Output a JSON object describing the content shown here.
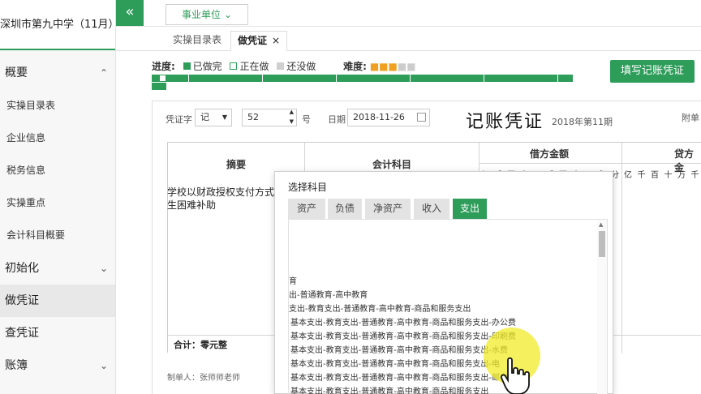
{
  "sidebar": {
    "school": "深圳市第九中学（11月）",
    "sections": [
      {
        "label": "概要",
        "chevron": "up"
      },
      {
        "label": "初始化",
        "chevron": "down"
      },
      {
        "label": "做凭证",
        "chevron": ""
      },
      {
        "label": "查凭证",
        "chevron": ""
      },
      {
        "label": "账簿",
        "chevron": "down"
      }
    ],
    "overview_items": [
      "实操目录表",
      "企业信息",
      "税务信息",
      "实操重点",
      "会计科目概要"
    ]
  },
  "topbar": {
    "collapse_icon": "«",
    "unit_select": "事业单位"
  },
  "tabs": {
    "tab1": "实操目录表",
    "tab2": "做凭证",
    "close": "×"
  },
  "progress": {
    "label": "进度:",
    "done": "已做完",
    "doing": "正在做",
    "todo": "还没做",
    "difficulty_label": "难度:",
    "difficulty_stars": 3,
    "difficulty_max": 5,
    "fill_button": "填写记账凭证",
    "total_steps": 59,
    "current_step": 2
  },
  "voucher": {
    "type_label": "凭证字",
    "type_value": "记",
    "number_value": "52",
    "number_suffix": "号",
    "date_label": "日期",
    "date_value": "2018-11-26",
    "title": "记账凭证",
    "period": "2018年第11期",
    "attach": "附单",
    "col_summary": "摘要",
    "col_account": "会计科目",
    "col_debit": "借方金额",
    "col_credit": "贷方金",
    "digits_debit": [
      "亿",
      "千",
      "百",
      "十",
      "万",
      "千",
      "百",
      "十",
      "元",
      "角",
      "分"
    ],
    "digits_credit": [
      "亿",
      "千",
      "百",
      "十",
      "万",
      "千"
    ],
    "summary_line1": "学校以财政授权支付方式",
    "summary_line2": "生困难补助",
    "total": "合计：零元整",
    "maker": "制单人：张师师老师"
  },
  "modal": {
    "title": "选择科目",
    "tabs": [
      "资产",
      "负债",
      "净资产",
      "收入",
      "支出"
    ],
    "active_tab": "支出",
    "items": [
      "育",
      "出-普通教育-高中教育",
      "支出-教育支出-普通教育-高中教育-商品和服务支出",
      "基本支出-教育支出-普通教育-高中教育-商品和服务支出-办公费",
      "基本支出-教育支出-普通教育-高中教育-商品和服务支出-印刷费",
      "基本支出-教育支出-普通教育-高中教育-商品和服务支出-水费",
      "基本支出-教育支出-普通教育-高中教育-商品和服务支出-电",
      "基本支出-教育支出-普通教育-高中教育-商品和服务支出-邮电费用",
      "基本支出-教育支出-普通教育-高中教育-商品和服务支出"
    ]
  },
  "colors": {
    "brand": "#2e9d5a",
    "highlight": "#f0eb28"
  }
}
